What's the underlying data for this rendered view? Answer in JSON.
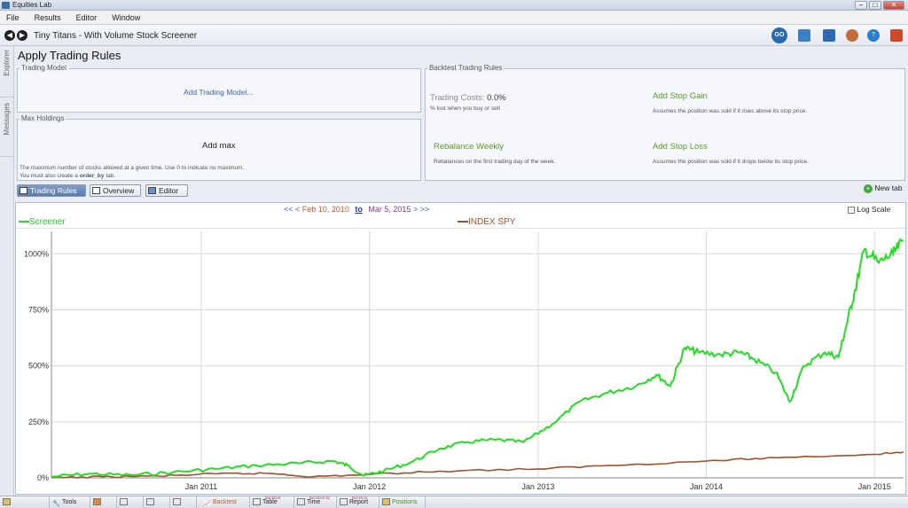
{
  "window": {
    "title": "Equities Lab",
    "controls": [
      "–",
      "□",
      "✕"
    ]
  },
  "menu": [
    "File",
    "Results",
    "Editor",
    "Window"
  ],
  "toolbar": {
    "screener_name": "Tiny Titans - With Volume Stock Screener",
    "go_label": "GO",
    "icons": [
      "back-icon",
      "forward-icon",
      "go-icon",
      "window-icon",
      "save-icon",
      "share-icon",
      "help-icon",
      "exit-icon"
    ]
  },
  "sidebar": {
    "tabs": [
      "Explorer",
      "Messages"
    ]
  },
  "page": {
    "heading": "Apply Trading Rules",
    "trading_model": {
      "legend": "Trading Model",
      "link": "Add Trading Model..."
    },
    "max_holdings": {
      "legend": "Max Holdings",
      "value": "Add max",
      "help_line1": "The maximum number of stocks allowed at a given time. Use 0 to indicate no maximum.",
      "help_line2_pre": "You must also create a ",
      "help_line2_bold": "order_by",
      "help_line2_post": " tab."
    },
    "backtest_rules": {
      "legend": "Backtest Trading Rules",
      "costs_label": "Trading Costs:",
      "costs_value": "0.0%",
      "costs_help": "% lost when you buy or sell",
      "stop_gain": "Add Stop Gain",
      "stop_gain_help": "Assumes the position was sold if it rises above its stop price.",
      "rebalance": "Rebalance Weekly",
      "rebalance_help": "Rebalances on the first trading day of the week.",
      "stop_loss": "Add Stop Loss",
      "stop_loss_help": "Assumes the position was sold if it drops below its stop price."
    }
  },
  "subtabs": [
    "Trading Rules",
    "Overview",
    "Editor"
  ],
  "new_tab": "New tab",
  "date_range": {
    "prev": "<< <",
    "start": "Feb 10, 2010",
    "to": "to",
    "end": "Mar 5, 2015",
    "next": "> >>"
  },
  "log_scale": "Log Scale",
  "chart_data": {
    "type": "line",
    "x_range": [
      "2010-02-10",
      "2015-03-05"
    ],
    "ylim": [
      0,
      1100
    ],
    "y_ticks": [
      0,
      250,
      500,
      750,
      1000
    ],
    "y_tick_labels": [
      "0%",
      "250%",
      "500%",
      "750%",
      "1000%"
    ],
    "x_ticks": [
      "Jan 2011",
      "Jan 2012",
      "Jan 2013",
      "Jan 2014",
      "Jan 2015"
    ],
    "grid": true,
    "legend_placement": "top",
    "series": [
      {
        "name": "Screener",
        "color": "#22dd22",
        "points": [
          [
            "2010-02-10",
            5
          ],
          [
            "2010-05-01",
            18
          ],
          [
            "2010-08-01",
            12
          ],
          [
            "2010-11-01",
            25
          ],
          [
            "2011-02-01",
            40
          ],
          [
            "2011-05-01",
            55
          ],
          [
            "2011-08-01",
            65
          ],
          [
            "2011-10-15",
            75
          ],
          [
            "2011-11-15",
            55
          ],
          [
            "2011-12-20",
            10
          ],
          [
            "2012-02-01",
            30
          ],
          [
            "2012-04-01",
            70
          ],
          [
            "2012-06-01",
            130
          ],
          [
            "2012-08-01",
            160
          ],
          [
            "2012-10-01",
            170
          ],
          [
            "2012-12-01",
            160
          ],
          [
            "2013-02-01",
            240
          ],
          [
            "2013-04-01",
            340
          ],
          [
            "2013-06-01",
            380
          ],
          [
            "2013-08-01",
            410
          ],
          [
            "2013-09-15",
            460
          ],
          [
            "2013-10-15",
            410
          ],
          [
            "2013-11-15",
            580
          ],
          [
            "2013-12-15",
            560
          ],
          [
            "2014-02-01",
            550
          ],
          [
            "2014-03-15",
            560
          ],
          [
            "2014-04-15",
            530
          ],
          [
            "2014-06-01",
            470
          ],
          [
            "2014-07-01",
            340
          ],
          [
            "2014-08-01",
            500
          ],
          [
            "2014-09-15",
            560
          ],
          [
            "2014-10-15",
            540
          ],
          [
            "2014-11-01",
            680
          ],
          [
            "2014-11-20",
            840
          ],
          [
            "2014-12-10",
            1020
          ],
          [
            "2015-01-10",
            960
          ],
          [
            "2015-02-10",
            1000
          ],
          [
            "2015-03-05",
            1060
          ]
        ]
      },
      {
        "name": "INDEX SPY",
        "color": "#a0522d",
        "points": [
          [
            "2010-02-10",
            0
          ],
          [
            "2010-06-01",
            5
          ],
          [
            "2010-10-01",
            8
          ],
          [
            "2011-02-01",
            18
          ],
          [
            "2011-06-01",
            20
          ],
          [
            "2011-09-01",
            5
          ],
          [
            "2012-01-01",
            15
          ],
          [
            "2012-06-01",
            30
          ],
          [
            "2013-01-01",
            40
          ],
          [
            "2013-06-01",
            55
          ],
          [
            "2014-01-01",
            75
          ],
          [
            "2014-06-01",
            90
          ],
          [
            "2015-01-01",
            105
          ],
          [
            "2015-03-05",
            115
          ]
        ]
      }
    ]
  },
  "bottom_tabs": [
    {
      "label": "Tools",
      "sub": ""
    },
    {
      "label": "Backtest",
      "sub": ""
    },
    {
      "label": "Table",
      "sub": "Backtest"
    },
    {
      "label": "Time",
      "sub": "Backtest by"
    },
    {
      "label": "Report",
      "sub": "Backtest"
    },
    {
      "label": "Positions",
      "sub": ""
    }
  ]
}
